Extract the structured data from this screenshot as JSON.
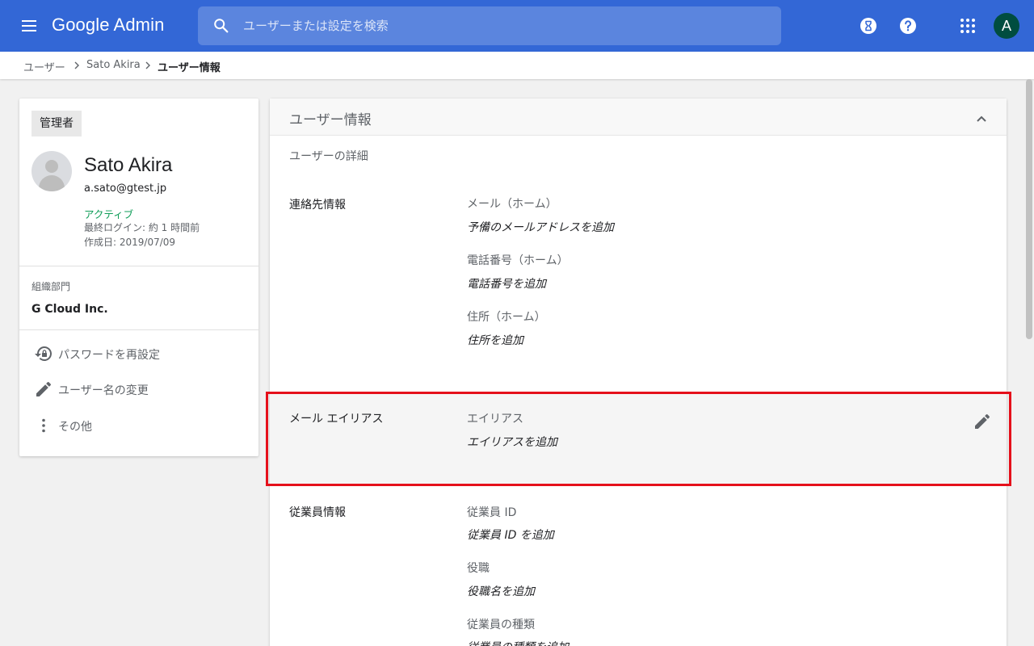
{
  "app": {
    "title": "Google Admin",
    "brand_color": "#3367d6"
  },
  "search": {
    "placeholder": "ユーザーまたは設定を検索"
  },
  "topbar": {
    "account_initial": "A",
    "icons": [
      "menu-icon",
      "search-icon",
      "hourglass-icon",
      "help-icon",
      "apps-grid-icon"
    ]
  },
  "breadcrumb": {
    "items": [
      "ユーザー",
      "Sato Akira",
      "ユーザー情報"
    ]
  },
  "user": {
    "role": "管理者",
    "name": "Sato Akira",
    "email": "a.sato@gtest.jp",
    "status": "アクティブ",
    "status_color": "#0f9d58",
    "last_login": "最終ログイン: 約 1 時間前",
    "created": "作成日: 2019/07/09",
    "org_label": "組織部門",
    "org_value": "G Cloud Inc."
  },
  "actions": [
    {
      "label": "パスワードを再設定",
      "icon": "lock-reset-icon"
    },
    {
      "label": "ユーザー名の変更",
      "icon": "pencil-icon"
    },
    {
      "label": "その他",
      "icon": "more-vert-icon"
    }
  ],
  "panel": {
    "title": "ユーザー情報",
    "subtitle": "ユーザーの詳細",
    "contact": {
      "label": "連絡先情報",
      "fields": [
        {
          "label": "メール（ホーム）",
          "value": "予備のメールアドレスを追加"
        },
        {
          "label": "電話番号（ホーム）",
          "value": "電話番号を追加"
        },
        {
          "label": "住所（ホーム）",
          "value": "住所を追加"
        }
      ]
    },
    "alias": {
      "label": "メール エイリアス",
      "field_label": "エイリアス",
      "field_value": "エイリアスを追加"
    },
    "employee": {
      "label": "従業員情報",
      "fields": [
        {
          "label": "従業員 ID",
          "value": "従業員 ID を追加"
        },
        {
          "label": "役職",
          "value": "役職名を追加"
        },
        {
          "label": "従業員の種類",
          "value": "従業員の種類を追加"
        }
      ]
    }
  },
  "highlight_color": "#e5101b"
}
